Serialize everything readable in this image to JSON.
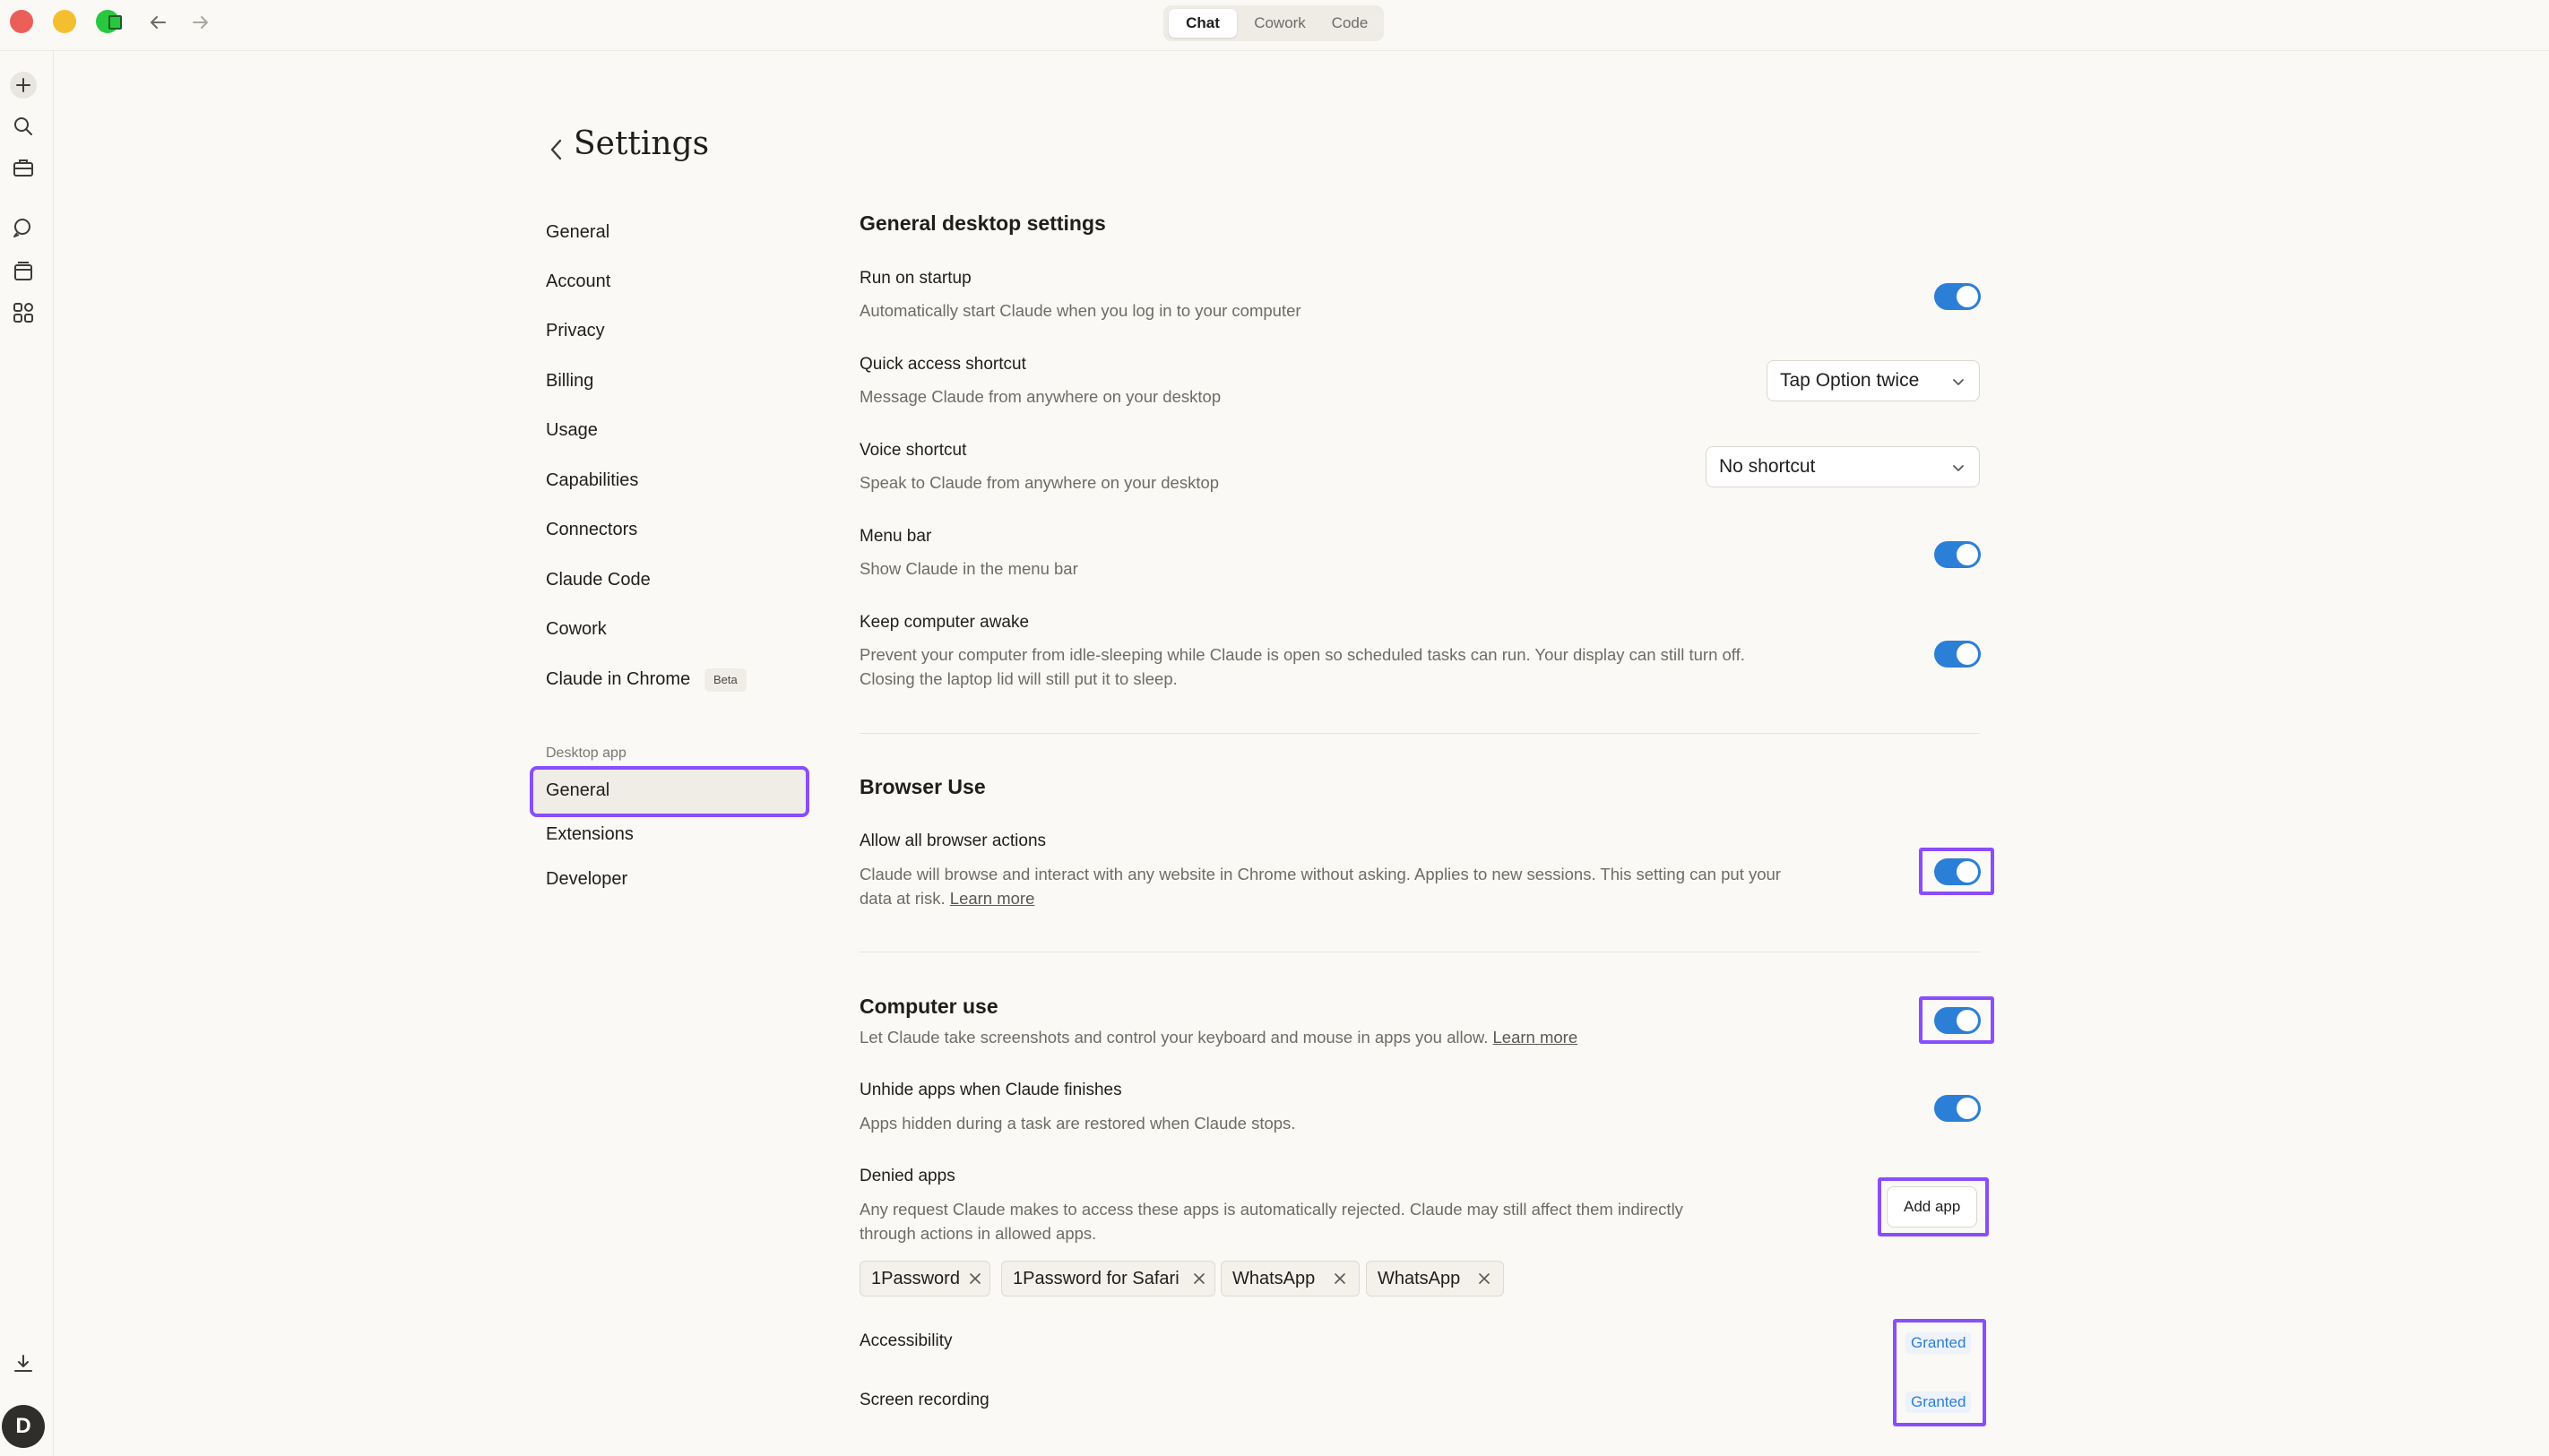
{
  "titlebar": {
    "modes": [
      "Chat",
      "Cowork",
      "Code"
    ],
    "active_mode": "Chat"
  },
  "rail": {
    "icons": [
      "plus-icon",
      "search-icon",
      "briefcase-icon",
      "chat-search-icon",
      "archive-icon",
      "apps-grid-icon",
      "download-icon"
    ],
    "avatar_initial": "D"
  },
  "page": {
    "title": "Settings"
  },
  "nav": {
    "items": [
      "General",
      "Account",
      "Privacy",
      "Billing",
      "Usage",
      "Capabilities",
      "Connectors",
      "Claude Code",
      "Cowork",
      "Claude in Chrome"
    ],
    "beta_badge": "Beta",
    "group_label": "Desktop app",
    "desktop_items": [
      "General",
      "Extensions",
      "Developer"
    ],
    "selected": "General"
  },
  "general": {
    "title": "General desktop settings",
    "run_on_startup": {
      "title": "Run on startup",
      "desc": "Automatically start Claude when you log in to your computer",
      "on": true
    },
    "quick_access": {
      "title": "Quick access shortcut",
      "desc": "Message Claude from anywhere on your desktop",
      "value": "Tap Option twice"
    },
    "voice_shortcut": {
      "title": "Voice shortcut",
      "desc": "Speak to Claude from anywhere on your desktop",
      "value": "No shortcut"
    },
    "menu_bar": {
      "title": "Menu bar",
      "desc": "Show Claude in the menu bar",
      "on": true
    },
    "keep_awake": {
      "title": "Keep computer awake",
      "desc1": "Prevent your computer from idle-sleeping while Claude is open so scheduled tasks can run. Your display can still turn off.",
      "desc2": "Closing the laptop lid will still put it to sleep.",
      "on": true
    }
  },
  "browser_use": {
    "title": "Browser Use",
    "allow_all": {
      "title": "Allow all browser actions",
      "desc1": "Claude will browse and interact with any website in Chrome without asking. Applies to new sessions. This setting can put your",
      "desc2": "data at risk.",
      "link": "Learn more",
      "on": true
    }
  },
  "computer_use": {
    "title": "Computer use",
    "desc": "Let Claude take screenshots and control your keyboard and mouse in apps you allow.",
    "link": "Learn more",
    "on": true,
    "unhide": {
      "title": "Unhide apps when Claude finishes",
      "desc": "Apps hidden during a task are restored when Claude stops.",
      "on": true
    },
    "denied": {
      "title": "Denied apps",
      "desc1": "Any request Claude makes to access these apps is automatically rejected. Claude may still affect them indirectly",
      "desc2": "through actions in allowed apps.",
      "add_label": "Add app",
      "apps": [
        "1Password",
        "1Password for Safari",
        "WhatsApp",
        "WhatsApp"
      ]
    },
    "accessibility": {
      "title": "Accessibility",
      "status": "Granted"
    },
    "screen_recording": {
      "title": "Screen recording",
      "status": "Granted"
    }
  },
  "colors": {
    "accent": "#2c7fd6",
    "highlight": "#8a4dff",
    "background": "#faf9f5"
  }
}
